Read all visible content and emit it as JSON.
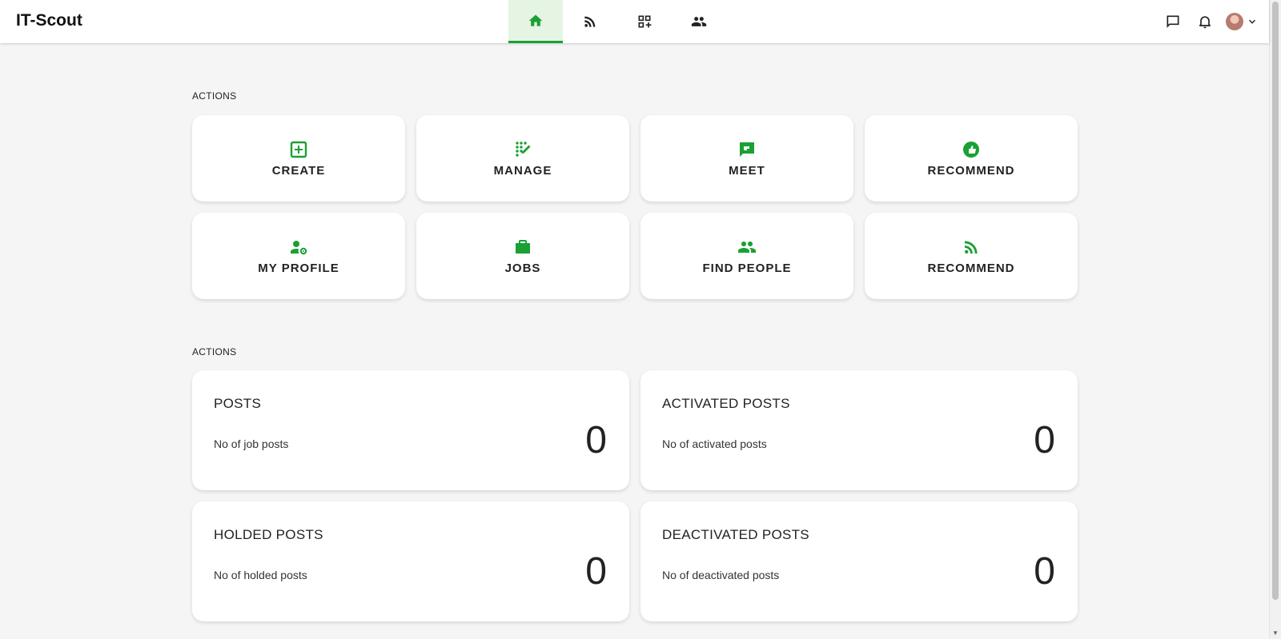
{
  "app": {
    "brand": "IT-Scout",
    "accent_color": "#1aa033"
  },
  "nav": {
    "tabs": [
      {
        "icon": "home-icon",
        "active": true
      },
      {
        "icon": "rss-feed-icon",
        "active": false
      },
      {
        "icon": "qr-code-add-icon",
        "active": false
      },
      {
        "icon": "people-icon",
        "active": false
      }
    ]
  },
  "header_right": {
    "icons": [
      "chat-icon",
      "bell-icon",
      "avatar",
      "chevron-down-icon"
    ]
  },
  "actions_section": {
    "label": "ACTIONS",
    "cards": [
      {
        "label": "CREATE",
        "icon": "add-box-icon"
      },
      {
        "label": "MANAGE",
        "icon": "dialpad-edit-icon"
      },
      {
        "label": "MEET",
        "icon": "chat-bubble-icon"
      },
      {
        "label": "RECOMMEND",
        "icon": "thumb-circle-icon"
      },
      {
        "label": "MY PROFILE",
        "icon": "person-settings-icon"
      },
      {
        "label": "JOBS",
        "icon": "briefcase-icon"
      },
      {
        "label": "FIND PEOPLE",
        "icon": "group-icon"
      },
      {
        "label": "RECOMMEND",
        "icon": "rss-feed-icon"
      }
    ]
  },
  "stats_section": {
    "label": "ACTIONS",
    "cards": [
      {
        "title": "POSTS",
        "description": "No of job posts",
        "value": "0"
      },
      {
        "title": "ACTIVATED POSTS",
        "description": "No of activated posts",
        "value": "0"
      },
      {
        "title": "HOLDED POSTS",
        "description": "No of holded posts",
        "value": "0"
      },
      {
        "title": "DEACTIVATED POSTS",
        "description": "No of deactivated posts",
        "value": "0"
      }
    ]
  }
}
